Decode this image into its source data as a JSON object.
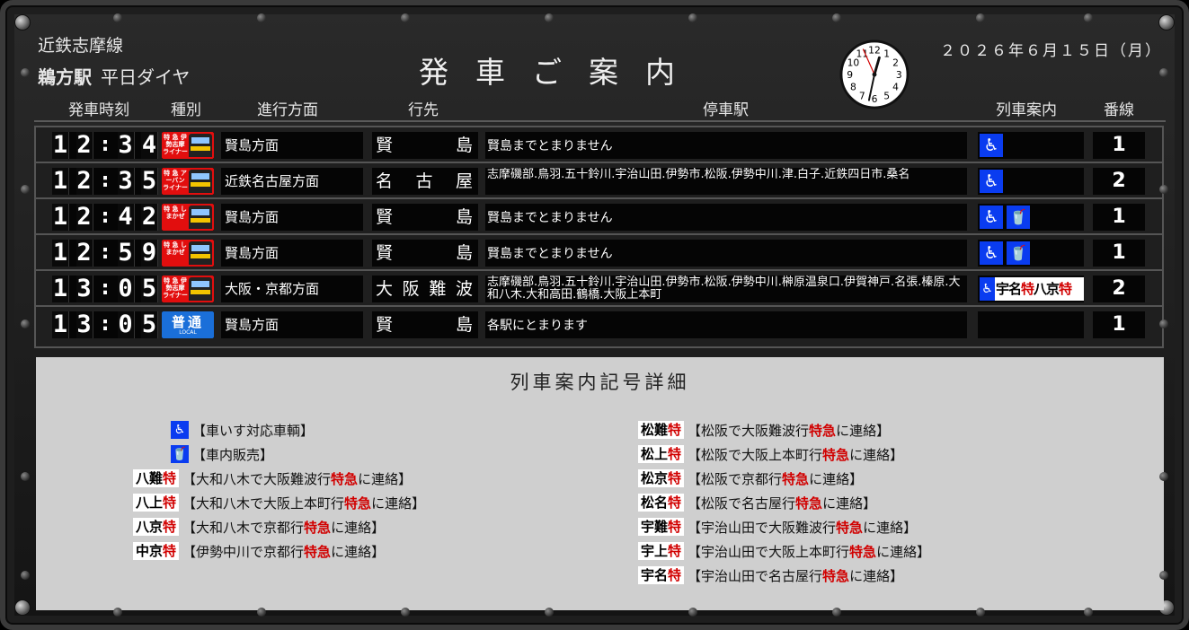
{
  "header": {
    "line_name": "近鉄志摩線",
    "station": "鵜方駅",
    "schedule": "平日ダイヤ",
    "title": "発車ご案内",
    "date": "２０２６年６月１５日（月）"
  },
  "clock": {
    "hour": 12,
    "minute": 32,
    "second": 56,
    "numbers": [
      "12",
      "1",
      "2",
      "3",
      "4",
      "5",
      "6",
      "7",
      "8",
      "9",
      "10",
      "11"
    ]
  },
  "columns": {
    "time": "発車時刻",
    "type": "種別",
    "direction": "進行方面",
    "destination": "行先",
    "stops": "停車駅",
    "info": "列車案内",
    "track": "番線"
  },
  "departures": [
    {
      "time": [
        "1",
        "2",
        "3",
        "4"
      ],
      "type_kind": "limited",
      "type_text": "特 急 伊勢志摩 ライナー",
      "direction": "賢島方面",
      "dest_chars": [
        "賢",
        "島"
      ],
      "stops": "賢島までとまりません",
      "info": [
        "wheelchair"
      ],
      "track": "1"
    },
    {
      "time": [
        "1",
        "2",
        "3",
        "5"
      ],
      "type_kind": "limited",
      "type_text": "特 急 アーバン ライナー",
      "direction": "近鉄名古屋方面",
      "dest_chars": [
        "名",
        "古",
        "屋"
      ],
      "stops": "志摩磯部.鳥羽.五十鈴川.宇治山田.伊勢市.松阪.伊勢中川.津.白子.近鉄四日市.桑名",
      "info": [
        "wheelchair"
      ],
      "track": "2"
    },
    {
      "time": [
        "1",
        "2",
        "4",
        "2"
      ],
      "type_kind": "limited",
      "type_text": "特 急 しまかぜ",
      "direction": "賢島方面",
      "dest_chars": [
        "賢",
        "島"
      ],
      "stops": "賢島までとまりません",
      "info": [
        "wheelchair",
        "sale"
      ],
      "track": "1"
    },
    {
      "time": [
        "1",
        "2",
        "5",
        "9"
      ],
      "type_kind": "limited",
      "type_text": "特 急 しまかぜ",
      "direction": "賢島方面",
      "dest_chars": [
        "賢",
        "島"
      ],
      "stops": "賢島までとまりません",
      "info": [
        "wheelchair",
        "sale"
      ],
      "track": "1"
    },
    {
      "time": [
        "1",
        "3",
        "0",
        "5"
      ],
      "type_kind": "limited",
      "type_text": "特 急 伊勢志摩 ライナー",
      "direction": "大阪・京都方面",
      "dest_chars": [
        "大",
        "阪",
        "難",
        "波"
      ],
      "stops": "志摩磯部.鳥羽.五十鈴川.宇治山田.伊勢市.松阪.伊勢中川.榊原温泉口.伊賀神戸.名張.榛原.大和八木.大和高田.鶴橋.大阪上本町",
      "info": [
        "combo"
      ],
      "info_combo": {
        "part1": "宇名",
        "red1": "特",
        "part2": "八京",
        "red2": "特"
      },
      "track": "2"
    },
    {
      "time": [
        "1",
        "3",
        "0",
        "5"
      ],
      "type_kind": "local",
      "type_text": "普通",
      "type_sub": "LOCAL",
      "direction": "賢島方面",
      "dest_chars": [
        "賢",
        "島"
      ],
      "stops": "各駅にとまります",
      "info": [],
      "track": "1"
    }
  ],
  "legend": {
    "title": "列車案内記号詳細",
    "left": [
      {
        "kind": "icon",
        "icon": "wheelchair",
        "text": "【車いす対応車輌】"
      },
      {
        "kind": "icon",
        "icon": "sale",
        "text": "【車内販売】"
      },
      {
        "kind": "key",
        "key": "八難",
        "t1": "【大和八木で大阪難波行",
        "t2": "特急",
        "t3": "に連絡】"
      },
      {
        "kind": "key",
        "key": "八上",
        "t1": "【大和八木で大阪上本町行",
        "t2": "特急",
        "t3": "に連絡】"
      },
      {
        "kind": "key",
        "key": "八京",
        "t1": "【大和八木で京都行",
        "t2": "特急",
        "t3": "に連絡】"
      },
      {
        "kind": "key",
        "key": "中京",
        "t1": "【伊勢中川で京都行",
        "t2": "特急",
        "t3": "に連絡】"
      }
    ],
    "right": [
      {
        "kind": "key",
        "key": "松難",
        "t1": "【松阪で大阪難波行",
        "t2": "特急",
        "t3": "に連絡】"
      },
      {
        "kind": "key",
        "key": "松上",
        "t1": "【松阪で大阪上本町行",
        "t2": "特急",
        "t3": "に連絡】"
      },
      {
        "kind": "key",
        "key": "松京",
        "t1": "【松阪で京都行",
        "t2": "特急",
        "t3": "に連絡】"
      },
      {
        "kind": "key",
        "key": "松名",
        "t1": "【松阪で名古屋行",
        "t2": "特急",
        "t3": "に連絡】"
      },
      {
        "kind": "key",
        "key": "宇難",
        "t1": "【宇治山田で大阪難波行",
        "t2": "特急",
        "t3": "に連絡】"
      },
      {
        "kind": "key",
        "key": "宇上",
        "t1": "【宇治山田で大阪上本町行",
        "t2": "特急",
        "t3": "に連絡】"
      },
      {
        "kind": "key",
        "key": "宇名",
        "t1": "【宇治山田で名古屋行",
        "t2": "特急",
        "t3": "に連絡】"
      }
    ],
    "key_suffix": "特"
  },
  "colors": {
    "limited": "#e20e0e",
    "local": "#1a6fd9",
    "icon_blue": "#0a3cf0",
    "legend_bg": "#cfcfcf",
    "accent_red": "#d10000"
  }
}
